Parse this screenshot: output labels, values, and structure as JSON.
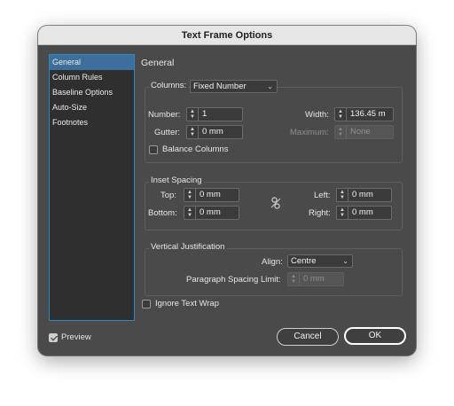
{
  "window": {
    "title": "Text Frame Options"
  },
  "sidebar": {
    "items": [
      {
        "label": "General"
      },
      {
        "label": "Column Rules"
      },
      {
        "label": "Baseline Options"
      },
      {
        "label": "Auto-Size"
      },
      {
        "label": "Footnotes"
      }
    ],
    "selected": "General"
  },
  "section_title": "General",
  "columns": {
    "label": "Columns:",
    "type_value": "Fixed Number",
    "number_label": "Number:",
    "number_value": "1",
    "gutter_label": "Gutter:",
    "gutter_value": "0 mm",
    "width_label": "Width:",
    "width_value": "136.45 m",
    "maximum_label": "Maximum:",
    "maximum_value": "None",
    "balance_label": "Balance Columns",
    "balance_checked": false
  },
  "inset": {
    "title": "Inset Spacing",
    "top_label": "Top:",
    "top_value": "0 mm",
    "bottom_label": "Bottom:",
    "bottom_value": "0 mm",
    "left_label": "Left:",
    "left_value": "0 mm",
    "right_label": "Right:",
    "right_value": "0 mm",
    "link_icon": "broken-chain-icon"
  },
  "vertical": {
    "title": "Vertical Justification",
    "align_label": "Align:",
    "align_value": "Centre",
    "psl_label": "Paragraph Spacing Limit:",
    "psl_value": "0 mm"
  },
  "ignore_wrap": {
    "label": "Ignore Text Wrap",
    "checked": false
  },
  "preview": {
    "label": "Preview",
    "checked": true
  },
  "buttons": {
    "cancel": "Cancel",
    "ok": "OK"
  }
}
